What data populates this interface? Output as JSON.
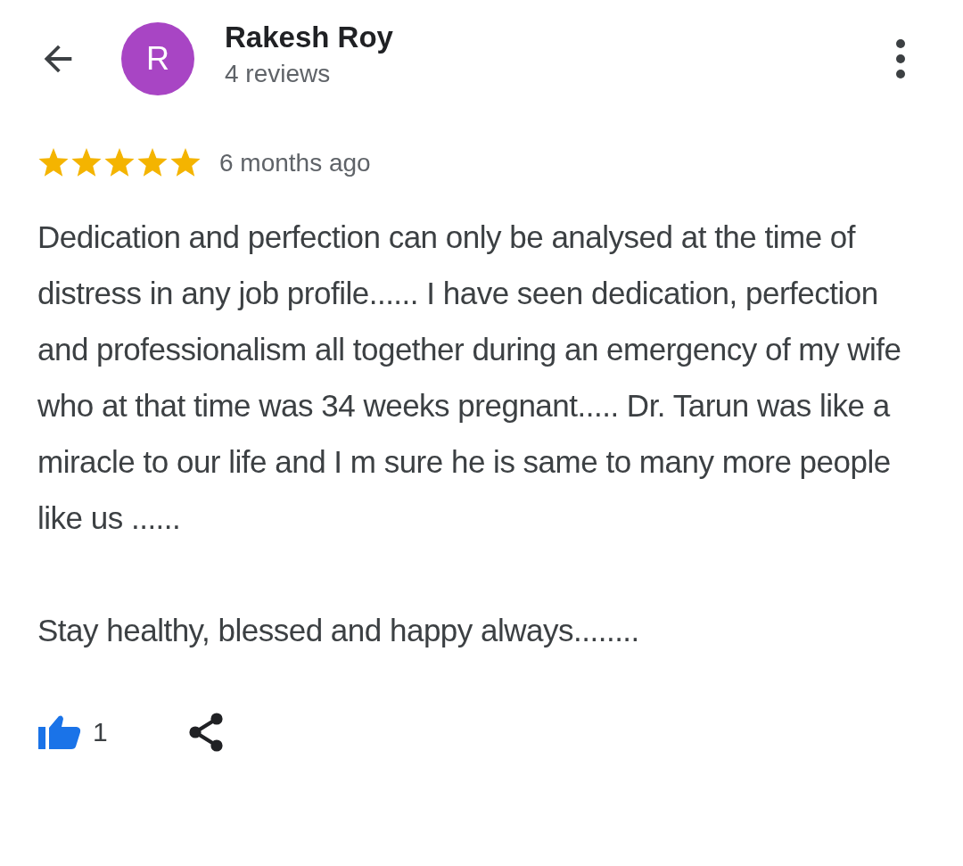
{
  "header": {
    "avatar_letter": "R",
    "name": "Rakesh Roy",
    "reviews": "4 reviews"
  },
  "review": {
    "stars": 5,
    "time": "6 months ago",
    "paragraphs": [
      "Dedication and perfection can only be analysed at the time of distress in any job profile...... I have seen dedication, perfection and professionalism all together during an emergency of my wife who at that time was 34 weeks pregnant..... Dr. Tarun was like a miracle to our life and I m sure he is same to many more people like us ......",
      "Stay healthy, blessed and happy always........"
    ]
  },
  "actions": {
    "liked": true,
    "likes": "1"
  }
}
